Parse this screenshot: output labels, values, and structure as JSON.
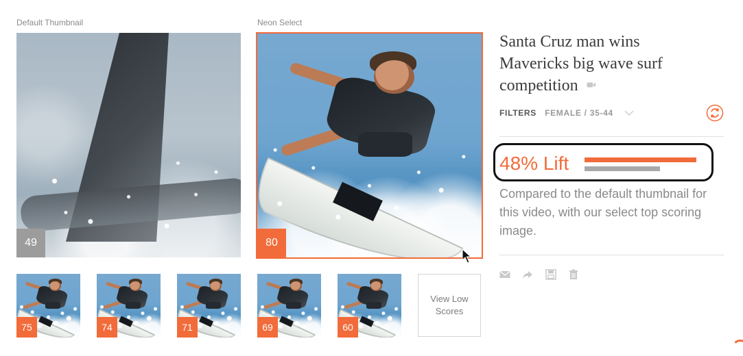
{
  "labels": {
    "default_thumbnail": "Default Thumbnail",
    "neon_select": "Neon Select"
  },
  "default_thumbnail": {
    "score": "49",
    "icon": "sailboat-photo"
  },
  "neon_select": {
    "score": "80",
    "icon": "surfer-photo"
  },
  "thumbnails": [
    {
      "score": "75"
    },
    {
      "score": "74"
    },
    {
      "score": "71"
    },
    {
      "score": "69"
    },
    {
      "score": "60"
    }
  ],
  "view_low_scores": "View Low Scores",
  "article": {
    "title": "Santa Cruz man wins Mavericks big wave surf competition"
  },
  "filters": {
    "label": "FILTERS",
    "value": "FEMALE / 35-44"
  },
  "lift": {
    "text": "48% Lift",
    "orange_fill": 1.0,
    "gray_fill": 0.675
  },
  "description": "Compared to the default thumbnail for this video, with our select top scoring image.",
  "actions": [
    {
      "icon": "mail-icon"
    },
    {
      "icon": "share-icon"
    },
    {
      "icon": "save-icon"
    },
    {
      "icon": "trash-icon"
    }
  ],
  "colors": {
    "accent": "#f26b3a",
    "gray_badge": "#9c9c9c",
    "text_muted": "#8a8a8a",
    "title": "#3b3b3b"
  }
}
